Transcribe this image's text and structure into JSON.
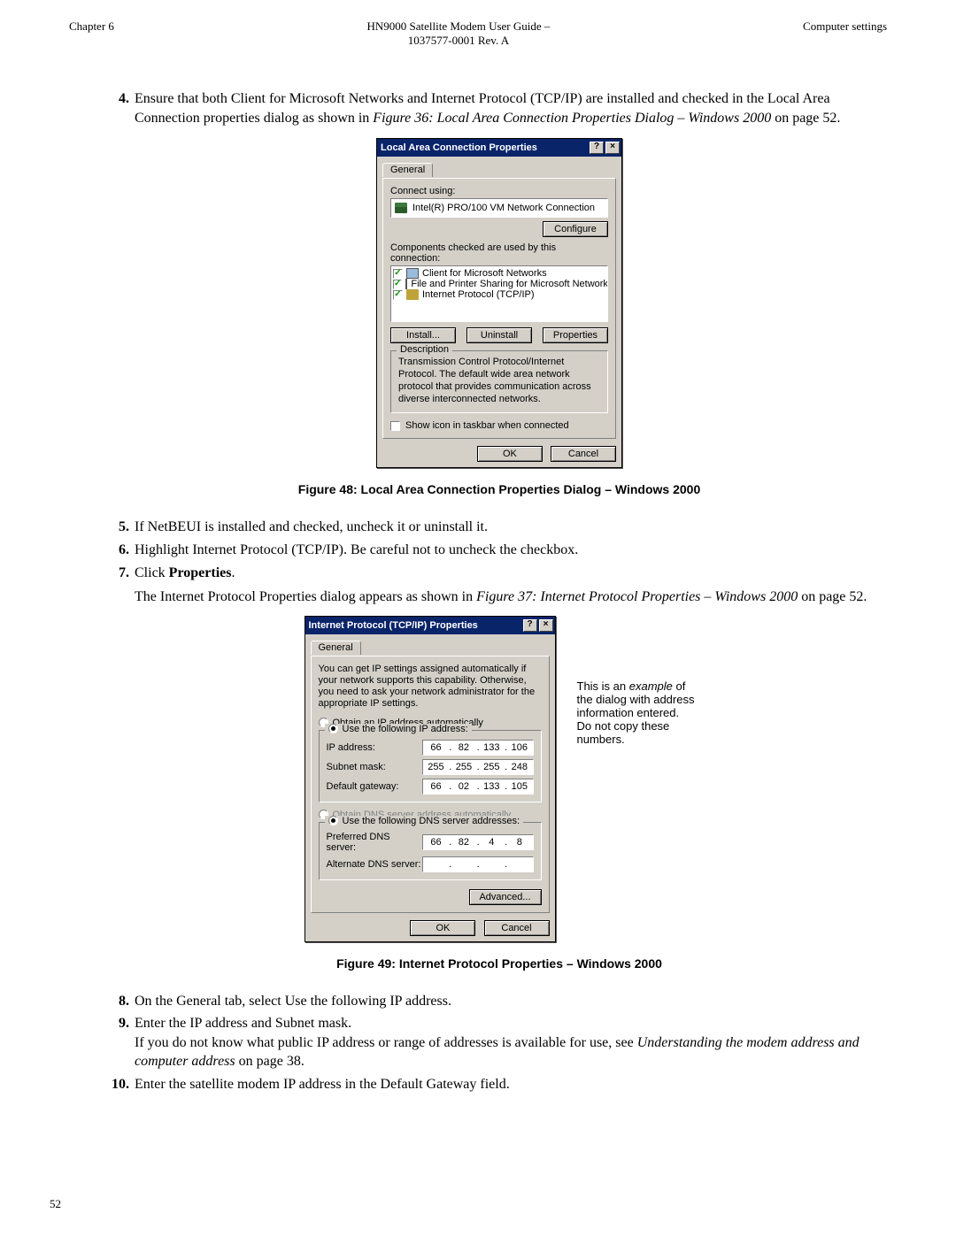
{
  "header": {
    "left": "Chapter 6",
    "center_line1": "HN9000 Satellite Modem User Guide –",
    "center_line2": "1037577-0001 Rev. A",
    "right": "Computer settings"
  },
  "page_number": "52",
  "steps": {
    "s4": {
      "num": "4.",
      "text_a": "Ensure that both Client for Microsoft Networks and Internet Protocol (TCP/IP) are installed and checked in the Local Area Connection properties dialog as shown in ",
      "ital": "Figure 36: Local Area Connection Properties Dialog – Windows 2000",
      "text_b": " on page 52."
    },
    "s5": {
      "num": "5.",
      "text": "If NetBEUI is installed and checked, uncheck it or uninstall it."
    },
    "s6": {
      "num": "6.",
      "text": "Highlight Internet Protocol (TCP/IP). Be careful not to uncheck the checkbox."
    },
    "s7": {
      "num": "7.",
      "text_a": "Click ",
      "bold": "Properties",
      "text_b": "."
    },
    "s7b": {
      "text_a": "The Internet Protocol Properties dialog appears as shown in ",
      "ital": "Figure 37: Internet Protocol Properties – Windows 2000",
      "text_b": " on page 52."
    },
    "s8": {
      "num": "8.",
      "text": "On the General tab, select Use the following IP address."
    },
    "s9": {
      "num": "9.",
      "text_a": "Enter the IP address and Subnet mask.",
      "text_b": "If you do not know what public IP address or range of addresses is available for use, see  ",
      "ital": "Understanding the modem address and computer address",
      "text_c": "  on page 38."
    },
    "s10": {
      "num": "10.",
      "text": "Enter the satellite modem IP address in the Default Gateway field."
    }
  },
  "fig48": {
    "caption": "Figure 48: Local Area Connection Properties Dialog – Windows 2000",
    "dlg_title": "Local Area Connection Properties",
    "tab": "General",
    "connect_label": "Connect using:",
    "adapter": "Intel(R) PRO/100 VM Network Connection",
    "configure_btn": "Configure",
    "components_label": "Components checked are used by this connection:",
    "components": [
      "Client for Microsoft Networks",
      "File and Printer Sharing for Microsoft Networks",
      "Internet Protocol (TCP/IP)"
    ],
    "install_btn": "Install...",
    "uninstall_btn": "Uninstall",
    "properties_btn": "Properties",
    "desc_legend": "Description",
    "description": "Transmission Control Protocol/Internet Protocol. The default wide area network protocol that provides communication across diverse interconnected networks.",
    "show_icon": "Show icon in taskbar when connected",
    "ok_btn": "OK",
    "cancel_btn": "Cancel"
  },
  "fig49": {
    "caption": "Figure 49: Internet Protocol Properties – Windows 2000",
    "dlg_title": "Internet Protocol (TCP/IP) Properties",
    "tab": "General",
    "blurb": "You can get IP settings assigned automatically if your network supports this capability. Otherwise, you need to ask your network administrator for the appropriate IP settings.",
    "auto_ip": "Obtain an IP address automatically",
    "use_ip": "Use the following IP address:",
    "ip_label": "IP address:",
    "subnet_label": "Subnet mask:",
    "gateway_label": "Default gateway:",
    "ip": [
      "66",
      "82",
      "133",
      "106"
    ],
    "subnet": [
      "255",
      "255",
      "255",
      "248"
    ],
    "gateway": [
      "66",
      "02",
      "133",
      "105"
    ],
    "auto_dns": "Obtain DNS server address automatically",
    "use_dns": "Use the following DNS server addresses:",
    "pref_dns_label": "Preferred DNS server:",
    "alt_dns_label": "Alternate DNS server:",
    "pref_dns": [
      "66",
      "82",
      "4",
      "8"
    ],
    "advanced_btn": "Advanced...",
    "ok_btn": "OK",
    "cancel_btn": "Cancel",
    "annotation": {
      "l1a": "This is an ",
      "l1b": "example",
      "l1c": " of",
      "l2": "the dialog with address",
      "l3": "information entered.",
      "l4": "Do not copy these",
      "l5": "numbers."
    }
  }
}
